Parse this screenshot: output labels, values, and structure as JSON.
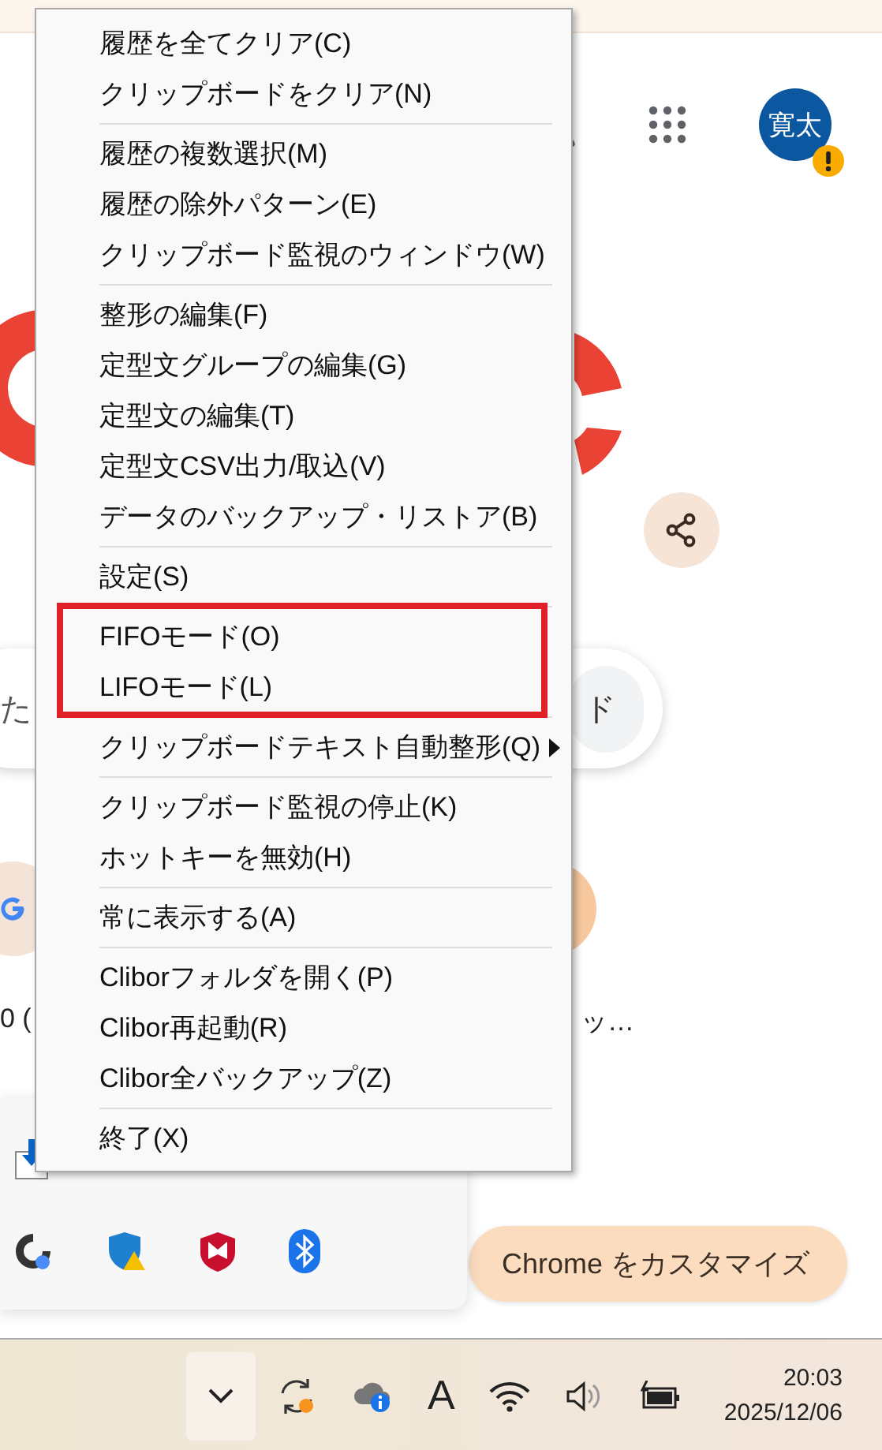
{
  "browser": {
    "profile_avatar": "寛太",
    "search_text_left": "た",
    "search_text_right": "ド",
    "shortcut_title_left": "0 (",
    "shortcut_title_right": "ッ…",
    "customize_button": "Chrome をカスタマイズ"
  },
  "context_menu": {
    "sections": [
      {
        "highlighted": false,
        "items": [
          {
            "label": "履歴を全てクリア(C)",
            "has_submenu": false
          },
          {
            "label": "クリップボードをクリア(N)",
            "has_submenu": false
          }
        ]
      },
      {
        "highlighted": false,
        "items": [
          {
            "label": "履歴の複数選択(M)",
            "has_submenu": false
          },
          {
            "label": "履歴の除外パターン(E)",
            "has_submenu": false
          },
          {
            "label": "クリップボード監視のウィンドウ(W)",
            "has_submenu": false
          }
        ]
      },
      {
        "highlighted": false,
        "items": [
          {
            "label": "整形の編集(F)",
            "has_submenu": false
          },
          {
            "label": "定型文グループの編集(G)",
            "has_submenu": false
          },
          {
            "label": "定型文の編集(T)",
            "has_submenu": false
          },
          {
            "label": "定型文CSV出力/取込(V)",
            "has_submenu": false
          },
          {
            "label": "データのバックアップ・リストア(B)",
            "has_submenu": false
          }
        ]
      },
      {
        "highlighted": false,
        "items": [
          {
            "label": "設定(S)",
            "has_submenu": false
          }
        ]
      },
      {
        "highlighted": true,
        "items": [
          {
            "label": "FIFOモード(O)",
            "has_submenu": false
          },
          {
            "label": "LIFOモード(L)",
            "has_submenu": false
          }
        ]
      },
      {
        "highlighted": false,
        "items": [
          {
            "label": "クリップボードテキスト自動整形(Q)",
            "has_submenu": true
          }
        ]
      },
      {
        "highlighted": false,
        "items": [
          {
            "label": "クリップボード監視の停止(K)",
            "has_submenu": false
          },
          {
            "label": "ホットキーを無効(H)",
            "has_submenu": false
          }
        ]
      },
      {
        "highlighted": false,
        "items": [
          {
            "label": "常に表示する(A)",
            "has_submenu": false
          }
        ]
      },
      {
        "highlighted": false,
        "items": [
          {
            "label": "Cliborフォルダを開く(P)",
            "has_submenu": false
          },
          {
            "label": "Clibor再起動(R)",
            "has_submenu": false
          },
          {
            "label": "Clibor全バックアップ(Z)",
            "has_submenu": false
          }
        ]
      },
      {
        "highlighted": false,
        "items": [
          {
            "label": "終了(X)",
            "has_submenu": false
          }
        ]
      }
    ]
  },
  "taskbar": {
    "ime_indicator": "A",
    "time": "20:03",
    "date": "2025/12/06"
  }
}
